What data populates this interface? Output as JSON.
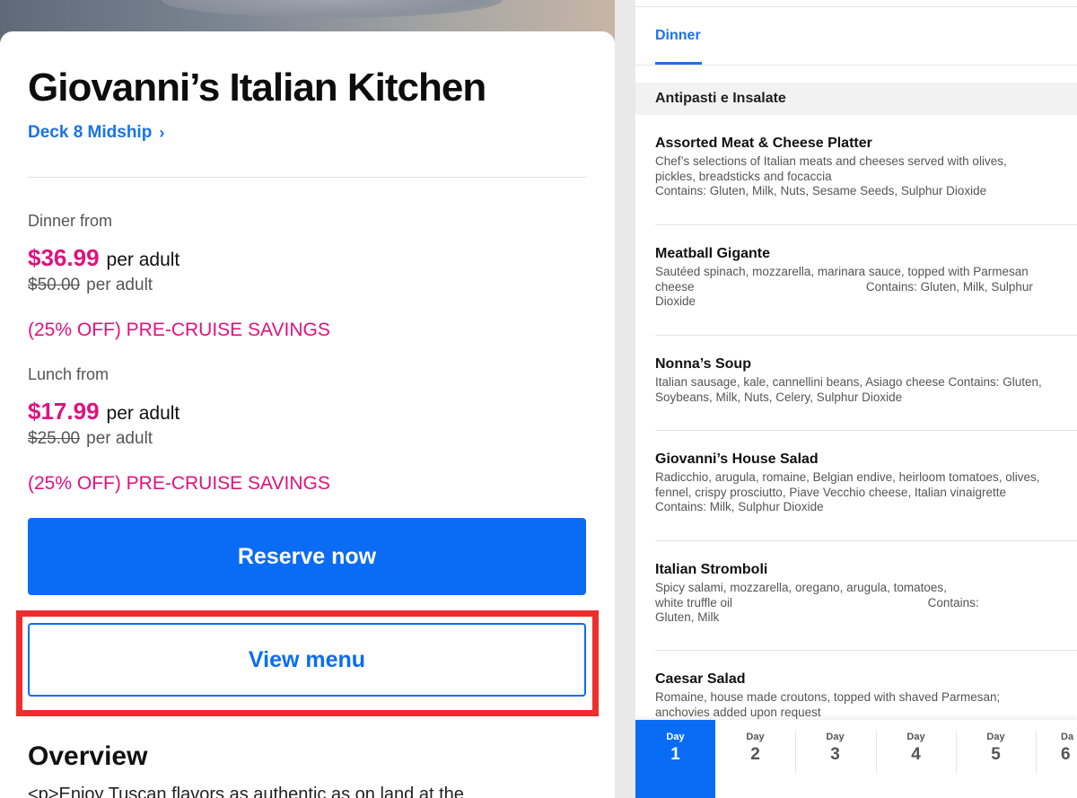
{
  "restaurant": {
    "title": "Giovanni’s Italian Kitchen",
    "location": "Deck 8 Midship",
    "location_icon": "chevron-right-icon"
  },
  "pricing": {
    "dinner": {
      "label": "Dinner from",
      "price": "$36.99",
      "per": "per adult",
      "old_price": "$50.00",
      "old_per": "per adult",
      "savings": "(25% OFF) PRE-CRUISE SAVINGS"
    },
    "lunch": {
      "label": "Lunch from",
      "price": "$17.99",
      "per": "per adult",
      "old_price": "$25.00",
      "old_per": "per adult",
      "savings": "(25% OFF) PRE-CRUISE SAVINGS"
    }
  },
  "actions": {
    "reserve": "Reserve now",
    "view_menu": "View menu"
  },
  "overview": {
    "heading": "Overview",
    "text": "<p>Enjoy Tuscan flavors as authentic as on land at the"
  },
  "menu": {
    "tab": "Dinner",
    "section": "Antipasti e Insalate",
    "items": [
      {
        "name": "Assorted Meat & Cheese Platter",
        "desc": "Chef’s selections of Italian meats and cheeses served with olives,\npickles, breadsticks and focaccia\nContains: Gluten, Milk, Nuts, Sesame Seeds, Sulphur Dioxide"
      },
      {
        "name": "Meatball Gigante",
        "desc": "Sautéed spinach, mozzarella, marinara sauce, topped with Parmesan\ncheese                                                   Contains: Gluten, Milk, Sulphur\nDioxide"
      },
      {
        "name": "Nonna’s Soup",
        "desc": "Italian sausage, kale, cannellini beans, Asiago cheese Contains: Gluten,\nSoybeans, Milk, Nuts, Celery, Sulphur Dioxide"
      },
      {
        "name": "Giovanni’s House Salad",
        "desc": "Radicchio, arugula, romaine, Belgian endive, heirloom tomatoes, olives,\nfennel, crispy prosciutto, Piave Vecchio cheese, Italian vinaigrette\nContains: Milk, Sulphur Dioxide"
      },
      {
        "name": "Italian Stromboli",
        "desc": "Spicy salami, mozzarella, oregano, arugula, tomatoes,\nwhite truffle oil                                                          Contains:\nGluten, Milk"
      },
      {
        "name": "Caesar Salad",
        "desc": "Romaine, house made croutons, topped with shaved Parmesan;\nanchovies added upon request"
      }
    ]
  },
  "days": [
    {
      "label": "Day",
      "num": "1"
    },
    {
      "label": "Day",
      "num": "2"
    },
    {
      "label": "Day",
      "num": "3"
    },
    {
      "label": "Day",
      "num": "4"
    },
    {
      "label": "Day",
      "num": "5"
    },
    {
      "label": "Da",
      "num": "6"
    }
  ],
  "colors": {
    "accent_blue": "#0a6cf5",
    "price_pink": "#e0117d",
    "highlight_red": "#ee2d2d"
  }
}
